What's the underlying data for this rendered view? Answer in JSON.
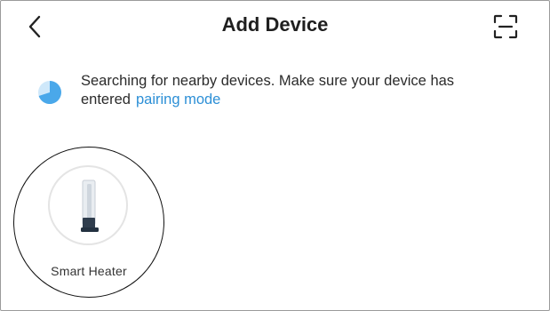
{
  "header": {
    "title": "Add Device",
    "back_icon": "chevron-left-icon",
    "scan_icon": "scan-icon"
  },
  "status": {
    "message": "Searching for nearby devices. Make sure your device has entered",
    "link_label": "pairing mode",
    "spinner_icon": "searching-spinner-icon",
    "link_color": "#2c8fd6",
    "spinner_color": "#4aa8ea"
  },
  "devices": [
    {
      "label": "Smart  Heater",
      "icon": "smart-heater-icon"
    }
  ]
}
